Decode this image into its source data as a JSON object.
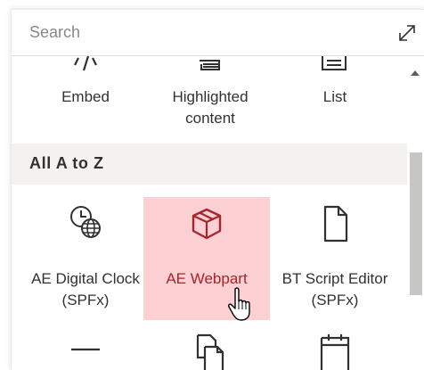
{
  "search": {
    "placeholder": "Search"
  },
  "icons": {
    "expand": "expand-diagonal-icon",
    "embed": "code-embed-icon",
    "highlighted": "stacked-pages-icon",
    "list": "list-icon",
    "clock": "clock-globe-icon",
    "package": "package-icon",
    "document": "document-icon",
    "divider": "divider-line-icon",
    "document_copy": "document-copy-icon",
    "calendar": "calendar-icon",
    "cursor": "hand-pointer-icon"
  },
  "colors": {
    "selected_bg": "#fdd0d3",
    "selected_text": "#a4262c",
    "section_bg": "#f3f2f1"
  },
  "top_tiles": [
    {
      "label": "Embed"
    },
    {
      "label": "Highlighted content"
    },
    {
      "label": "List"
    }
  ],
  "section": {
    "title": "All A to Z"
  },
  "az_tiles": [
    {
      "label": "AE Digital Clock (SPFx)"
    },
    {
      "label": "AE Webpart"
    },
    {
      "label": "BT Script Editor (SPFx)"
    }
  ]
}
